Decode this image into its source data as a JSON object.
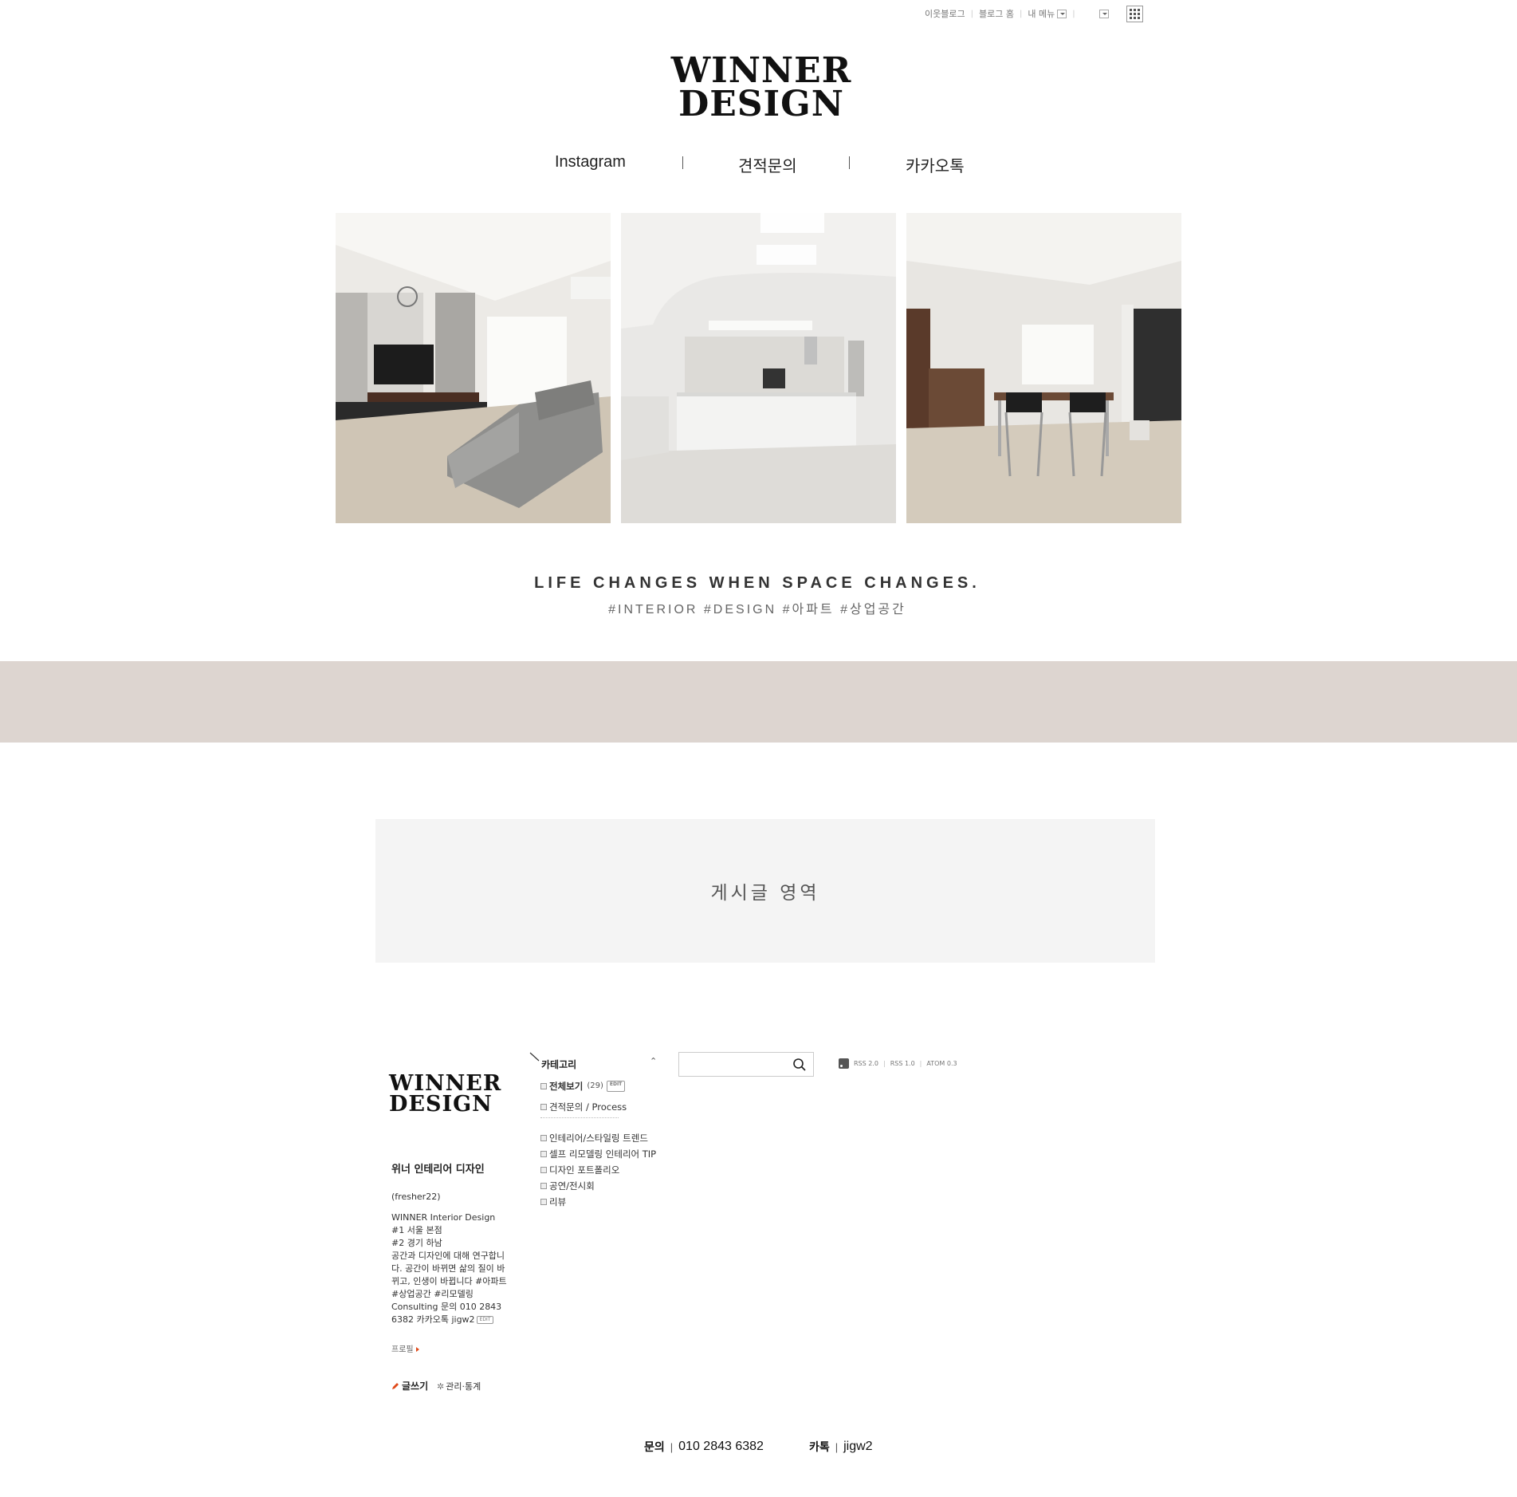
{
  "topbar": {
    "neighbor_blog": "이웃블로그",
    "blog_home": "블로그 홈",
    "my_menu": "내 메뉴"
  },
  "logo": {
    "line1": "WINNER",
    "line2": "DESIGN"
  },
  "nav": [
    {
      "label": "Instagram"
    },
    {
      "label": "견적문의"
    },
    {
      "label": "카카오톡"
    }
  ],
  "tagline": "LIFE CHANGES WHEN SPACE CHANGES.",
  "hashtags": "#INTERIOR #DESIGN #아파트 #상업공간",
  "post_area": "게시글 영역",
  "profile": {
    "name": "위너 인테리어 디자인",
    "id": "(fresher22)",
    "description": "WINNER Interior Design\n#1 서울 본점\n#2 경기 하남\n공간과 디자인에 대해 연구합니다. 공간이 바뀌면 삶의 질이 바뀌고, 인생이 바뀝니다 #아파트 #상업공간 #리모델링\nConsulting 문의 010 2843 6382 카카오톡 jigw2",
    "edit_badge": "EDIT",
    "profile_link": "프로필",
    "write": "글쓰기",
    "admin": "관리·통계"
  },
  "category": {
    "title": "카테고리",
    "all": {
      "label": "전체보기",
      "count": "(29)",
      "badge": "EDIT"
    },
    "top_items": [
      {
        "label": "견적문의 / Process"
      }
    ],
    "items": [
      {
        "label": "인테리어/스타일링 트렌드"
      },
      {
        "label": "셀프 리모델링 인테리어 TIP"
      },
      {
        "label": "디자인 포트폴리오"
      },
      {
        "label": "공연/전시회"
      },
      {
        "label": "리뷰"
      }
    ]
  },
  "search": {
    "value": ""
  },
  "rss": {
    "rss2": "RSS 2.0",
    "rss1": "RSS 1.0",
    "atom": "ATOM 0.3"
  },
  "footer": {
    "contact_label": "문의",
    "phone": "010 2843 6382",
    "kakao_label": "카톡",
    "kakao_id": "jigw2"
  }
}
